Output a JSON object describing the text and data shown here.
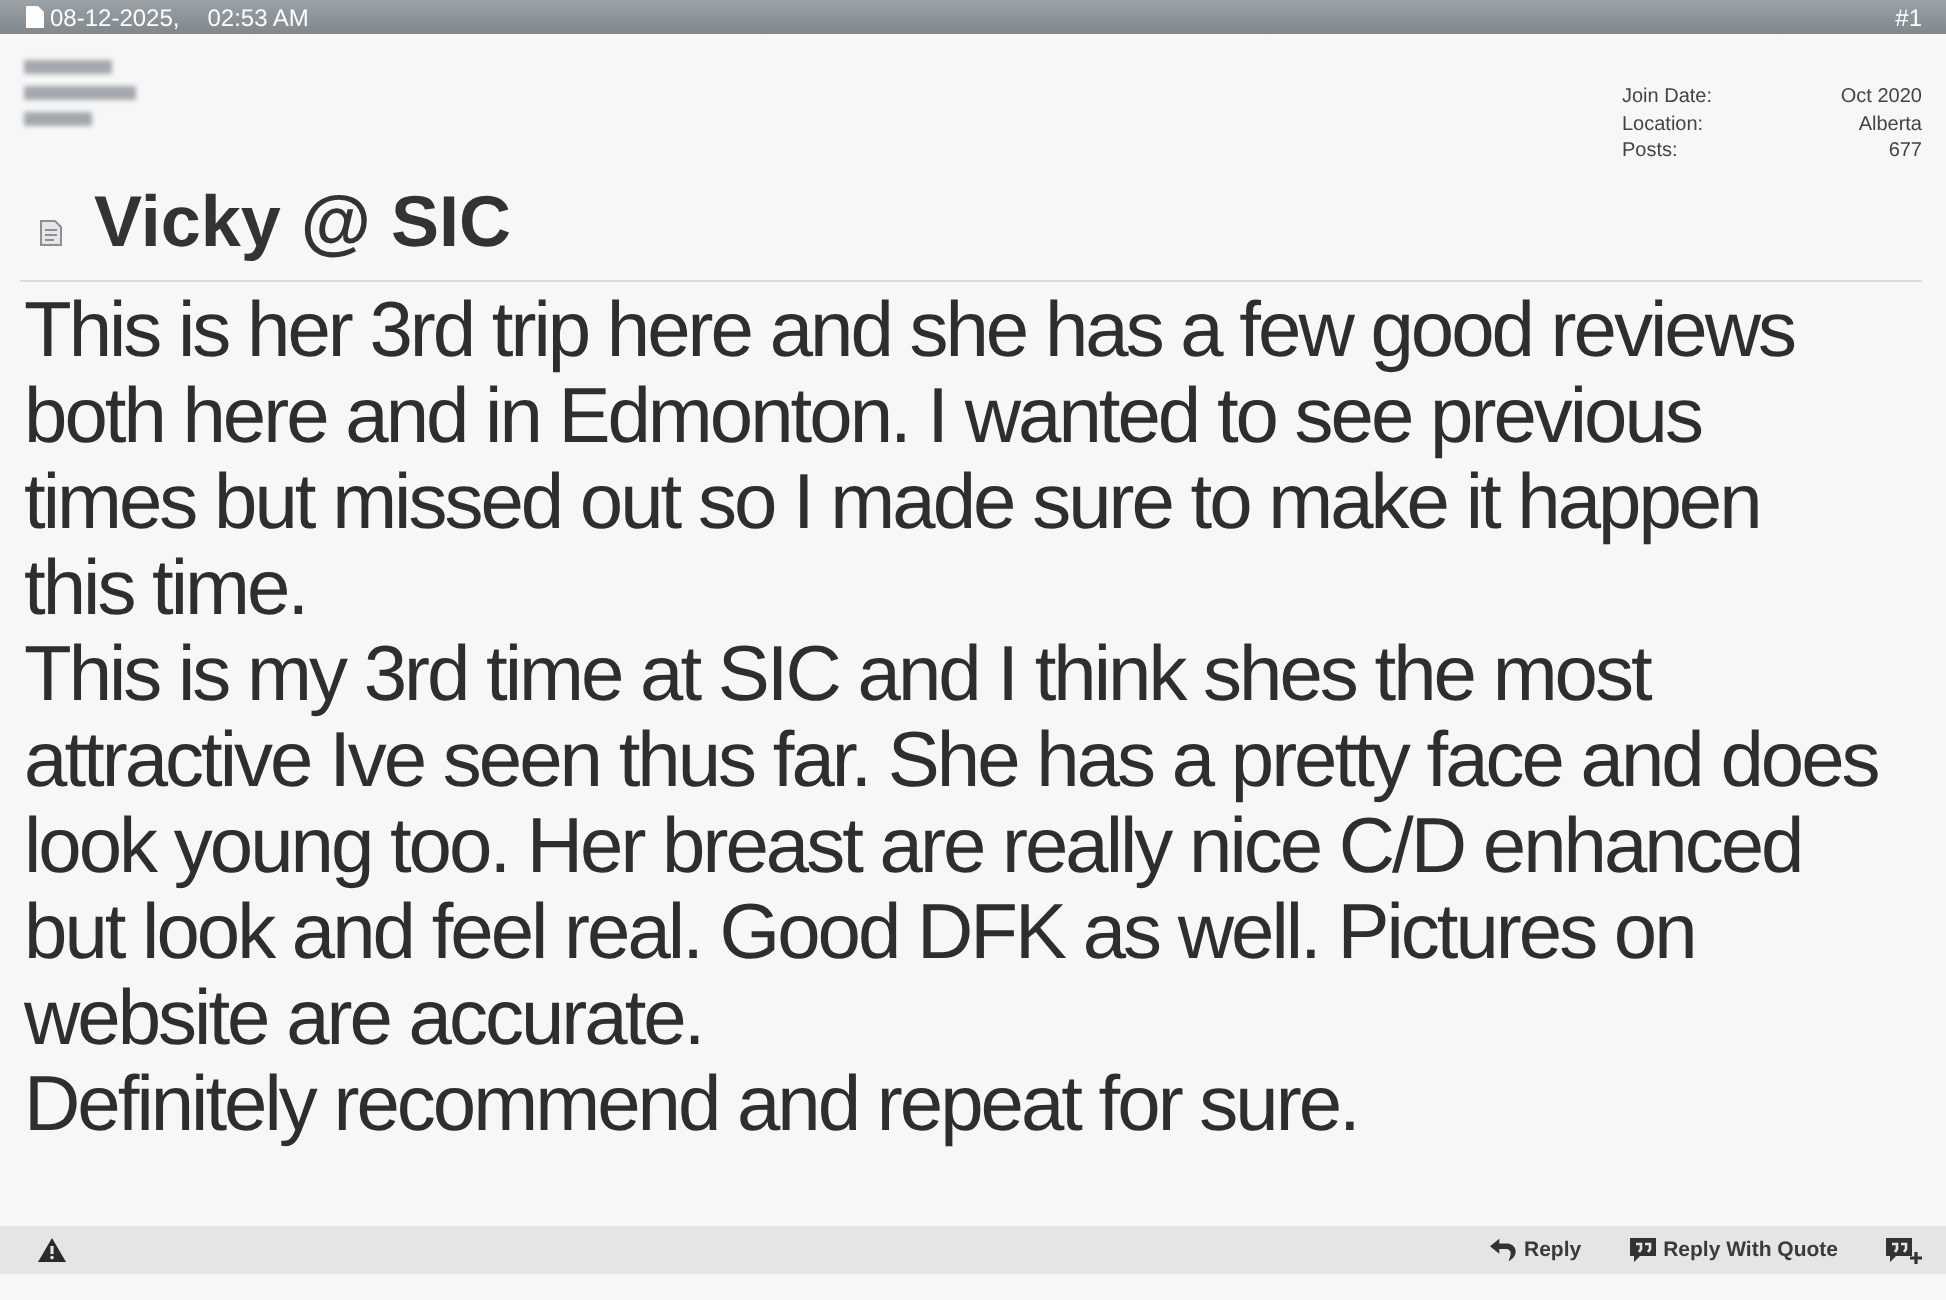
{
  "post_header": {
    "date": "08-12-2025,",
    "time": "02:53 AM",
    "post_number": "#1"
  },
  "user_info": {
    "stats": [
      {
        "label": "Join Date:",
        "value": "Oct 2020"
      },
      {
        "label": "Location:",
        "value": "Alberta"
      },
      {
        "label": "Posts:",
        "value": "677"
      }
    ]
  },
  "post": {
    "title": "Vicky @ SIC",
    "paragraphs": [
      "This is her 3rd trip here and she has a few good reviews both here and in Edmonton. I wanted to see previous times but missed out so I made sure to make it happen this time.",
      "This is my 3rd time at SIC and I think shes the most attractive Ive seen thus far. She has a pretty face and does look young too. Her breast are really nice C/D enhanced but look and feel real. Good DFK as well. Pictures on website are accurate.",
      "Definitely recommend and repeat for sure."
    ]
  },
  "footer": {
    "buttons": [
      {
        "kind": "reply",
        "label": "Reply"
      },
      {
        "kind": "quote",
        "label": "Reply With Quote"
      },
      {
        "kind": "multiquote"
      }
    ]
  }
}
